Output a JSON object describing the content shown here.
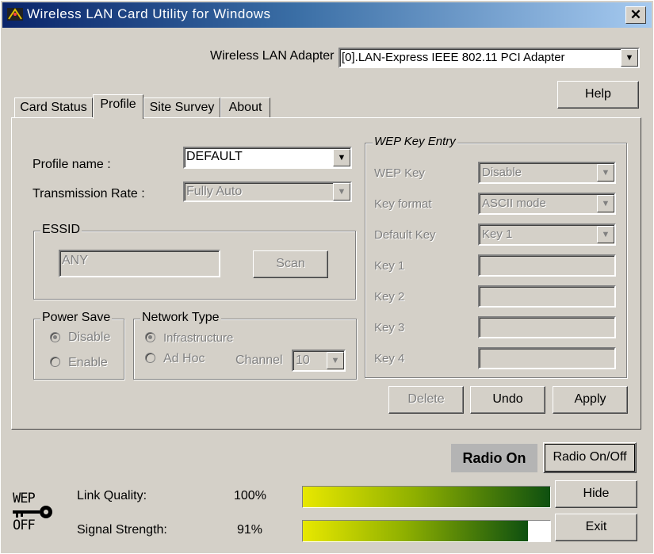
{
  "window": {
    "title": "Wireless LAN Card Utility for Windows",
    "close_label": "✕"
  },
  "adapter": {
    "label": "Wireless LAN Adapter",
    "value": "[0].LAN-Express IEEE 802.11 PCI Adapter"
  },
  "help_label": "Help",
  "tabs": [
    {
      "label": "Card Status"
    },
    {
      "label": "Profile"
    },
    {
      "label": "Site Survey"
    },
    {
      "label": "About"
    }
  ],
  "profile": {
    "name_label": "Profile name :",
    "name_value": "DEFAULT",
    "rate_label": "Transmission Rate :",
    "rate_value": "Fully Auto"
  },
  "essid": {
    "title": "ESSID",
    "value": "ANY",
    "scan_label": "Scan"
  },
  "power_save": {
    "title": "Power Save",
    "disable": "Disable",
    "enable": "Enable"
  },
  "network_type": {
    "title": "Network Type",
    "infrastructure": "Infrastructure",
    "adhoc": "Ad Hoc",
    "channel_label": "Channel",
    "channel_value": "10"
  },
  "wep": {
    "title": "WEP Key Entry",
    "wep_key_label": "WEP Key",
    "wep_key_value": "Disable",
    "key_format_label": "Key format",
    "key_format_value": "ASCII mode",
    "default_key_label": "Default Key",
    "default_key_value": "Key 1",
    "key1_label": "Key 1",
    "key2_label": "Key 2",
    "key3_label": "Key 3",
    "key4_label": "Key 4"
  },
  "actions": {
    "delete": "Delete",
    "undo": "Undo",
    "apply": "Apply"
  },
  "radio": {
    "status": "Radio On",
    "toggle_label": "Radio On/Off"
  },
  "status": {
    "wep_badge_top": "WEP",
    "wep_badge_bottom": "OFF",
    "link_quality_label": "Link Quality:",
    "link_quality_value": "100%",
    "link_quality_level": 1.0,
    "signal_strength_label": "Signal Strength:",
    "signal_strength_value": "91%",
    "signal_strength_level": 0.91
  },
  "hide_label": "Hide",
  "exit_label": "Exit"
}
